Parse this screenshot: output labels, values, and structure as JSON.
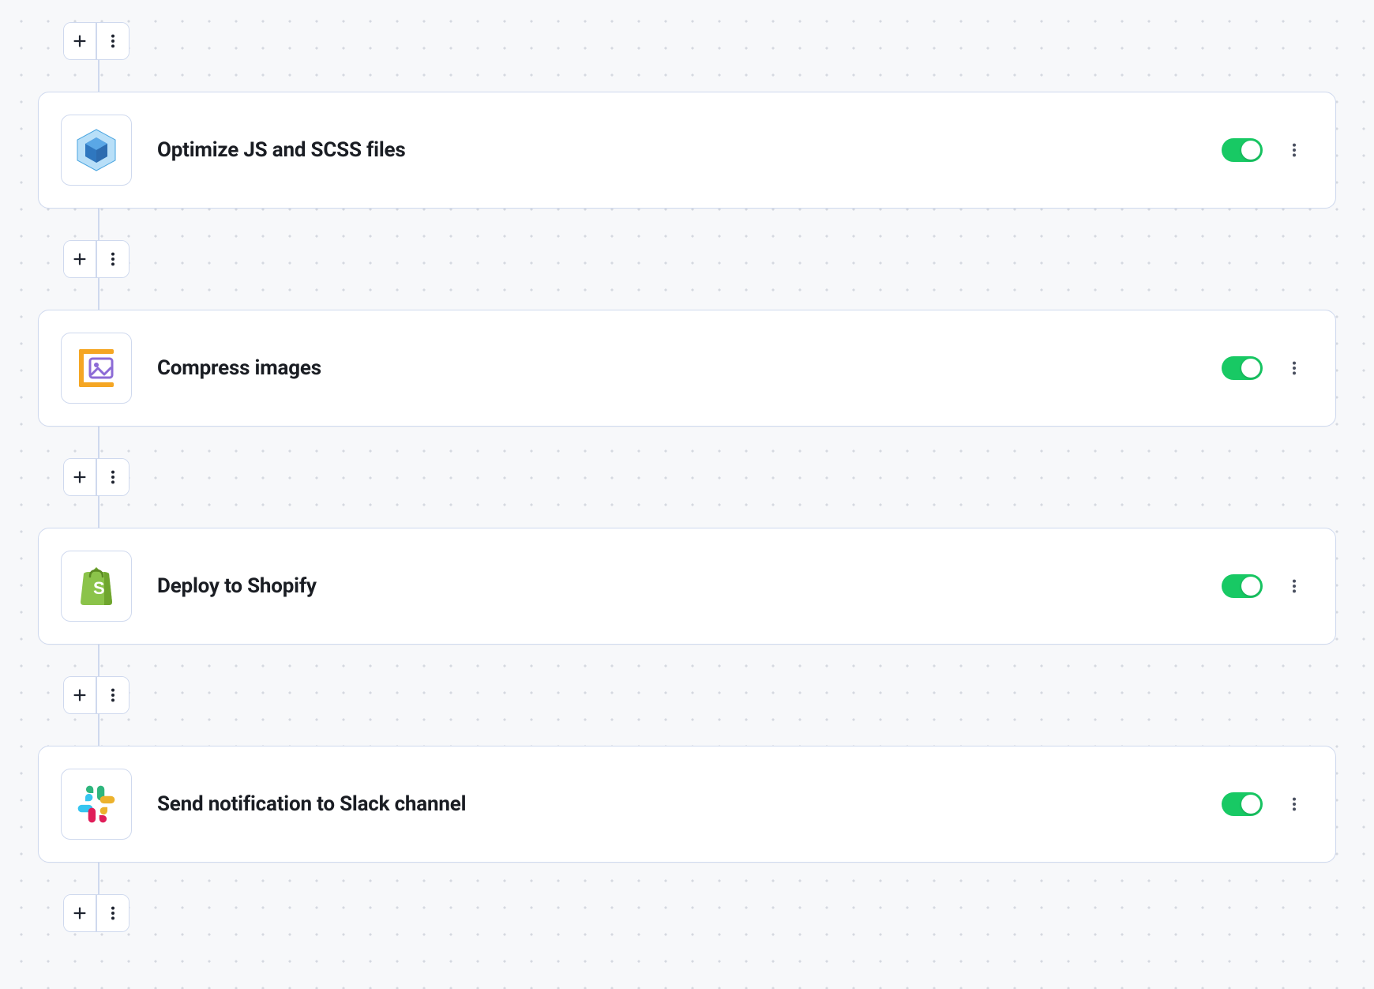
{
  "steps": [
    {
      "icon": "webpack-icon",
      "title": "Optimize JS and SCSS files",
      "enabled": true
    },
    {
      "icon": "compress-icon",
      "title": "Compress images",
      "enabled": true
    },
    {
      "icon": "shopify-icon",
      "title": "Deploy to Shopify",
      "enabled": true
    },
    {
      "icon": "slack-icon",
      "title": "Send notification to Slack channel",
      "enabled": true
    }
  ],
  "colors": {
    "toggle_on": "#18c964",
    "card_border": "#cfd9ee"
  }
}
